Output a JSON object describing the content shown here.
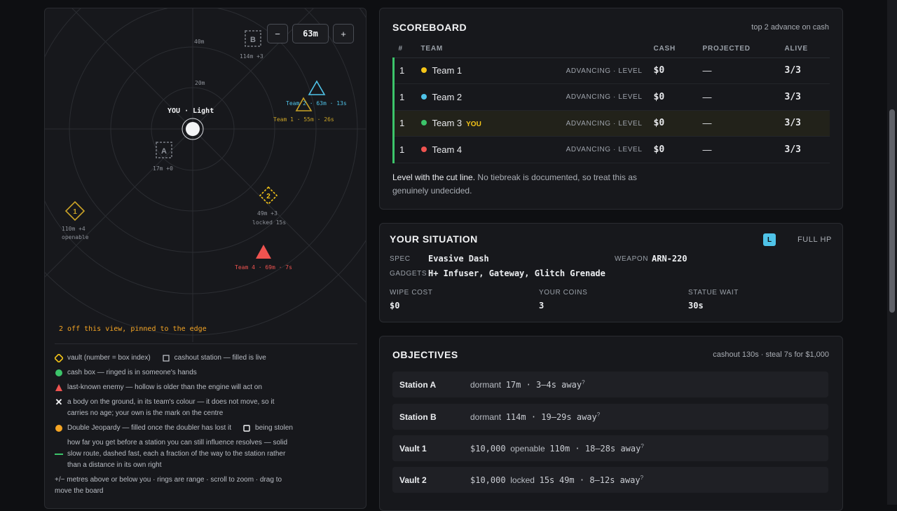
{
  "map": {
    "zoom": {
      "minus": "−",
      "value": "63m",
      "plus": "+"
    },
    "ring_labels": [
      "40m",
      "20m"
    ],
    "you_label": "YOU · Light",
    "station_a": {
      "letter": "A",
      "label": "17m +0"
    },
    "station_b": {
      "letter": "B",
      "label": "114m +3"
    },
    "vault_1": {
      "number": "1",
      "label1": "110m +4",
      "label2": "openable"
    },
    "vault_2": {
      "number": "2",
      "label1": "49m +3",
      "label2": "locked 15s"
    },
    "enemies": {
      "team2": {
        "label": "Team 2 · 63m · 13s",
        "color": "#4fc3e8"
      },
      "team1": {
        "label": "Team 1 · 55m · 26s",
        "color": "#c9a227"
      },
      "team4": {
        "label": "Team 4 · 69m · 7s",
        "color": "#ef5350"
      }
    },
    "pinned_note": "2 off this view, pinned to the edge"
  },
  "legend": {
    "vault": "vault (number = box index)",
    "cashout": "cashout station — filled is live",
    "cashbox": "cash box — ringed is in someone's hands",
    "enemy": "last-known enemy — hollow is older than the engine will act on",
    "body": "a body on the ground, in its team's colour — it does not move, so it carries no age; your own is the mark on the centre",
    "double": "Double Jeopardy — filled once the doubler has lost it",
    "stolen": "being stolen",
    "route": "how far you get before a station you can still influence resolves — solid slow route, dashed fast, each a fraction of the way to the station rather than a distance in its own right",
    "controls": "+/− metres above or below you · rings are range · scroll to zoom · drag to move the board"
  },
  "scoreboard": {
    "title": "SCOREBOARD",
    "subtitle": "top 2 advance on cash",
    "headers": {
      "rank": "#",
      "team": "TEAM",
      "cash": "CASH",
      "projected": "PROJECTED",
      "alive": "ALIVE"
    },
    "you_tag": "YOU",
    "rows": [
      {
        "rank": "1",
        "team": "Team 1",
        "color": "#f5c518",
        "status": "ADVANCING · LEVEL",
        "cash": "$0",
        "projected": "—",
        "alive": "3/3"
      },
      {
        "rank": "1",
        "team": "Team 2",
        "color": "#4fc3e8",
        "status": "ADVANCING · LEVEL",
        "cash": "$0",
        "projected": "—",
        "alive": "3/3"
      },
      {
        "rank": "1",
        "team": "Team 3",
        "color": "#3cc46a",
        "status": "ADVANCING · LEVEL",
        "cash": "$0",
        "projected": "—",
        "alive": "3/3"
      },
      {
        "rank": "1",
        "team": "Team 4",
        "color": "#ef5350",
        "status": "ADVANCING · LEVEL",
        "cash": "$0",
        "projected": "—",
        "alive": "3/3"
      }
    ],
    "note_bold": "Level with the cut line.",
    "note_rest": " No tiebreak is documented, so treat this as genuinely undecided."
  },
  "situation": {
    "title": "YOUR SITUATION",
    "badge": "L",
    "hp": "FULL HP",
    "spec_label": "SPEC",
    "spec": "Evasive Dash",
    "weapon_label": "WEAPON",
    "weapon": "ARN-220",
    "gadgets_label": "GADGETS",
    "gadgets": "H+ Infuser, Gateway, Glitch Grenade",
    "wipe_label": "WIPE COST",
    "wipe": "$0",
    "coins_label": "YOUR COINS",
    "coins": "3",
    "statue_label": "STATUE WAIT",
    "statue": "30s"
  },
  "objectives": {
    "title": "OBJECTIVES",
    "subtitle": "cashout 130s · steal 7s for $1,000",
    "rows": [
      {
        "name": "Station A",
        "value": "",
        "state": "dormant",
        "timer": "",
        "distance": "17m · 3–4s away"
      },
      {
        "name": "Station B",
        "value": "",
        "state": "dormant",
        "timer": "",
        "distance": "114m · 19–29s away"
      },
      {
        "name": "Vault 1",
        "value": "$10,000",
        "state": "openable",
        "timer": "",
        "distance": "110m · 18–28s away"
      },
      {
        "name": "Vault 2",
        "value": "$10,000",
        "state": "locked",
        "timer": "15s",
        "distance": "49m · 8–12s away"
      }
    ],
    "hint": "?"
  },
  "colors": {
    "you_row": "#22221a",
    "advancing": "#3cc46a",
    "accent": "#f5a524"
  }
}
